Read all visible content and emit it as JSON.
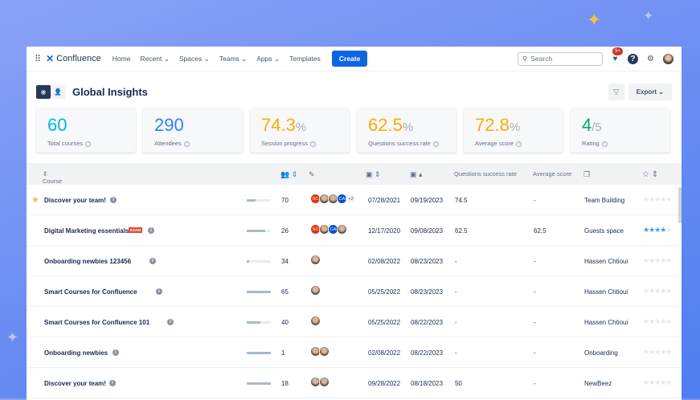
{
  "topbar": {
    "app": "Confluence",
    "nav": [
      "Home",
      "Recent",
      "Spaces",
      "Teams",
      "Apps",
      "Templates"
    ],
    "create": "Create",
    "search_placeholder": "Search",
    "notif_badge": "9+",
    "help": "?"
  },
  "page": {
    "title": "Global Insights",
    "export": "Export"
  },
  "cards": [
    {
      "value": "60",
      "unit": "",
      "label": "Total courses",
      "color": "#00b8d9"
    },
    {
      "value": "290",
      "unit": "",
      "label": "Attendees",
      "color": "#2684ff"
    },
    {
      "value": "74.3",
      "unit": "%",
      "label": "Session progress",
      "color": "#ffab00"
    },
    {
      "value": "62.5",
      "unit": "%",
      "label": "Questions success rate",
      "color": "#ffab00"
    },
    {
      "value": "72.8",
      "unit": "%",
      "label": "Average score",
      "color": "#ffab00"
    },
    {
      "value": "4",
      "unit": "/5",
      "label": "Rating",
      "color": "#00a86b"
    }
  ],
  "table": {
    "headers": {
      "course": "Course",
      "qsr": "Questions success rate",
      "avg": "Average score"
    },
    "rows": [
      {
        "name": "Discover your team!",
        "starred": true,
        "exam": false,
        "progress": 35,
        "attendees": "70",
        "avatars": [
          "SC",
          "p",
          "p",
          "CA"
        ],
        "more": "+2",
        "created": "07/28/2021",
        "updated": "09/19/2023",
        "qsr": "74.5",
        "avg": "-",
        "space": "Team Building",
        "rating": 0
      },
      {
        "name": "Digital Marketing essentials",
        "starred": false,
        "exam": "EXAM",
        "progress": 75,
        "attendees": "26",
        "avatars": [
          "SC",
          "p",
          "CA",
          "p"
        ],
        "created": "12/17/2020",
        "updated": "09/08/2023",
        "qsr": "62.5",
        "avg": "62.5",
        "space": "Guests space",
        "rating": 4
      },
      {
        "name": "Onboarding newbies 123456",
        "progress": 10,
        "attendees": "34",
        "avatars": [
          "p"
        ],
        "created": "02/08/2022",
        "updated": "08/23/2023",
        "qsr": "-",
        "avg": "-",
        "space": "Hassen Chtioui",
        "rating": 0
      },
      {
        "name": "Smart Courses for Confluence",
        "progress": 100,
        "attendees": "65",
        "avatars": [
          "p"
        ],
        "created": "05/25/2022",
        "updated": "08/23/2023",
        "qsr": "-",
        "avg": "-",
        "space": "Hassen Chtioui",
        "rating": 0
      },
      {
        "name": "Smart Courses for Confluence 101",
        "progress": 55,
        "attendees": "40",
        "avatars": [
          "p"
        ],
        "created": "05/25/2022",
        "updated": "08/22/2023",
        "qsr": "-",
        "avg": "-",
        "space": "Hassen Chtioui",
        "rating": 0
      },
      {
        "name": "Onboarding newbies",
        "progress": 100,
        "attendees": "1",
        "avatars": [
          "p",
          "p"
        ],
        "created": "02/08/2022",
        "updated": "08/22/2023",
        "qsr": "-",
        "avg": "-",
        "space": "Onboarding",
        "rating": 0
      },
      {
        "name": "Discover your team!",
        "progress": 100,
        "attendees": "18",
        "avatars": [
          "p",
          "p"
        ],
        "created": "09/28/2022",
        "updated": "08/18/2023",
        "qsr": "50",
        "avg": "-",
        "space": "NewBeez",
        "rating": 0
      }
    ]
  }
}
